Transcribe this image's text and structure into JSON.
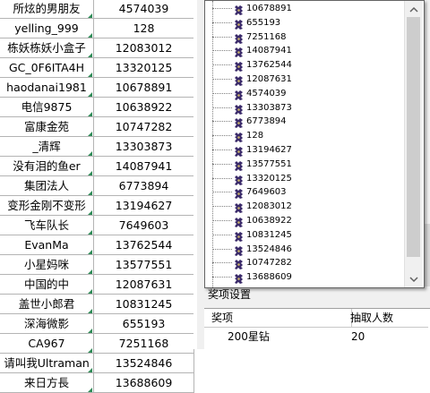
{
  "sheet": {
    "rows": [
      {
        "name": "所炫的男朋友",
        "id": "4574039"
      },
      {
        "name": "yelling_999",
        "id": "128"
      },
      {
        "name": "栋妖栋妖小盒子",
        "id": "12083012"
      },
      {
        "name": "GC_0F6ITA4H",
        "id": "13320125"
      },
      {
        "name": "haodanai1981",
        "id": "10678891"
      },
      {
        "name": "电信9875",
        "id": "10638922"
      },
      {
        "name": "富康金苑",
        "id": "10747282"
      },
      {
        "name": "_清辉",
        "id": "13303873"
      },
      {
        "name": "没有泪的鱼er",
        "id": "14087941"
      },
      {
        "name": "集团法人",
        "id": "6773894"
      },
      {
        "name": "变形金刚不变形",
        "id": "13194627"
      },
      {
        "name": "飞车队长",
        "id": "7649603"
      },
      {
        "name": "EvanMa",
        "id": "13762544"
      },
      {
        "name": "小星妈咪",
        "id": "13577551"
      },
      {
        "name": "中国的中",
        "id": "12087631"
      },
      {
        "name": "盖世小郎君",
        "id": "10831245"
      },
      {
        "name": "深海微影",
        "id": "655193"
      },
      {
        "name": "CA967",
        "id": "7251168"
      },
      {
        "name": "请叫我Ultraman",
        "id": "13524846"
      },
      {
        "name": "来日方長",
        "id": "13688609"
      }
    ]
  },
  "dropdown": {
    "items": [
      "10678891",
      "655193",
      "7251168",
      "14087941",
      "13762544",
      "12087631",
      "4574039",
      "13303873",
      "6773894",
      "128",
      "13194627",
      "13577551",
      "13320125",
      "7649603",
      "12083012",
      "10638922",
      "10831245",
      "13524846",
      "10747282",
      "13688609"
    ]
  },
  "prize": {
    "group_label": "奖项设置",
    "col_prize": "奖项",
    "col_count": "抽取人数",
    "rows": [
      {
        "prize": "200星钻",
        "count": "20"
      }
    ]
  },
  "colors": {
    "comment_marker": "#2e8b57",
    "icon": "#3a2a6a"
  }
}
